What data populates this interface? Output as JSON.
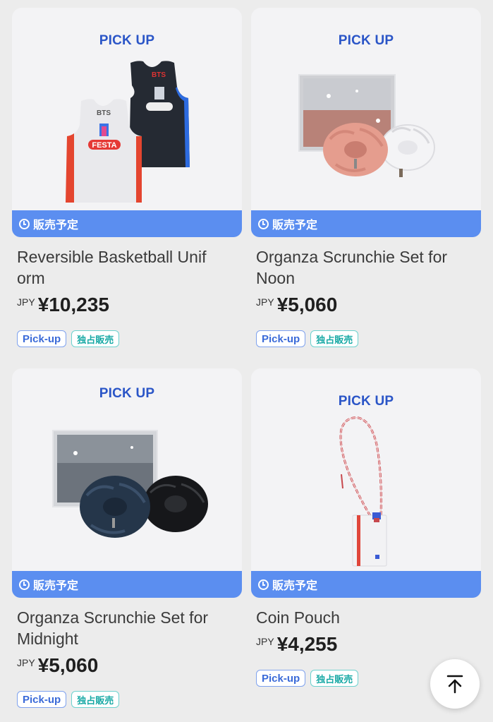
{
  "products": [
    {
      "pickup": "PICK UP",
      "status": "販売予定",
      "name": "Reversible Basketball Unif­orm",
      "name_line1": "Reversible Basketball Unif",
      "name_line2": "orm",
      "currency": "JPY",
      "price": "¥10,235",
      "tags": [
        "Pick-up",
        "独占販売"
      ],
      "jersey_text": "BTS",
      "jersey_logo": "FESTA"
    },
    {
      "pickup": "PICK UP",
      "status": "販売予定",
      "name_line1": "Organza Scrunchie Set for",
      "name_line2": "Noon",
      "currency": "JPY",
      "price": "¥5,060",
      "tags": [
        "Pick-up",
        "独占販売"
      ]
    },
    {
      "pickup": "PICK UP",
      "status": "販売予定",
      "name_line1": "Organza Scrunchie Set for",
      "name_line2": "Midnight",
      "currency": "JPY",
      "price": "¥5,060",
      "tags": [
        "Pick-up",
        "独占販売"
      ]
    },
    {
      "pickup": "PICK UP",
      "status": "販売予定",
      "name_line1": "Coin Pouch",
      "name_line2": "",
      "currency": "JPY",
      "price": "¥4,255",
      "tags": [
        "Pick-up",
        "独占販売"
      ]
    }
  ],
  "colors": {
    "pickup_blue": "#2a55c7",
    "status_bar": "#5b8ef0",
    "tag_blue": "#3a6ad8",
    "tag_teal": "#18a9a5"
  },
  "icons": [
    "clock-icon",
    "arrow-up-to-top-icon"
  ]
}
